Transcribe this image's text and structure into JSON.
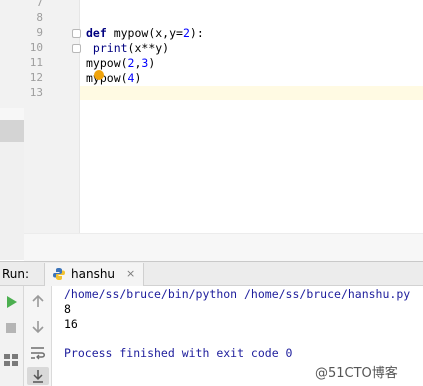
{
  "editor": {
    "line_numbers": [
      "7",
      "8",
      "9",
      "10",
      "11",
      "12",
      "13"
    ],
    "code": {
      "line9": {
        "keyword": "def",
        "signature": " mypow(x,y=",
        "default": "2",
        "tail": "):"
      },
      "line10": {
        "fn": " print",
        "args": "(x**y)"
      },
      "line11": {
        "call": "mypow(",
        "arg1": "2",
        "comma": ",",
        "arg2": "3",
        "close": ")"
      },
      "line12": {
        "call": "mypow(",
        "arg1": "4",
        "close": ")"
      }
    }
  },
  "run": {
    "label": "Run:",
    "tab": {
      "name": "hanshu",
      "close": "×"
    },
    "console": {
      "command": "/home/ss/bruce/bin/python /home/ss/bruce/hanshu.py",
      "output": [
        "8",
        "16"
      ],
      "finished": "Process finished with exit code 0"
    }
  },
  "watermark": "@51CTO博客",
  "icons": {
    "run": "run-icon",
    "stop": "stop-icon",
    "up": "up-arrow-icon",
    "down": "down-arrow-icon",
    "wrap": "soft-wrap-icon",
    "scroll": "scroll-to-end-icon",
    "layout": "layout-icon",
    "python": "python-icon"
  },
  "colors": {
    "keyword": "#000080",
    "number": "#0000ff",
    "console_system": "#1d1d9c",
    "run_green": "#4caf50",
    "caret_line": "#fffae3",
    "intention_bulb": "#f0a30a"
  }
}
